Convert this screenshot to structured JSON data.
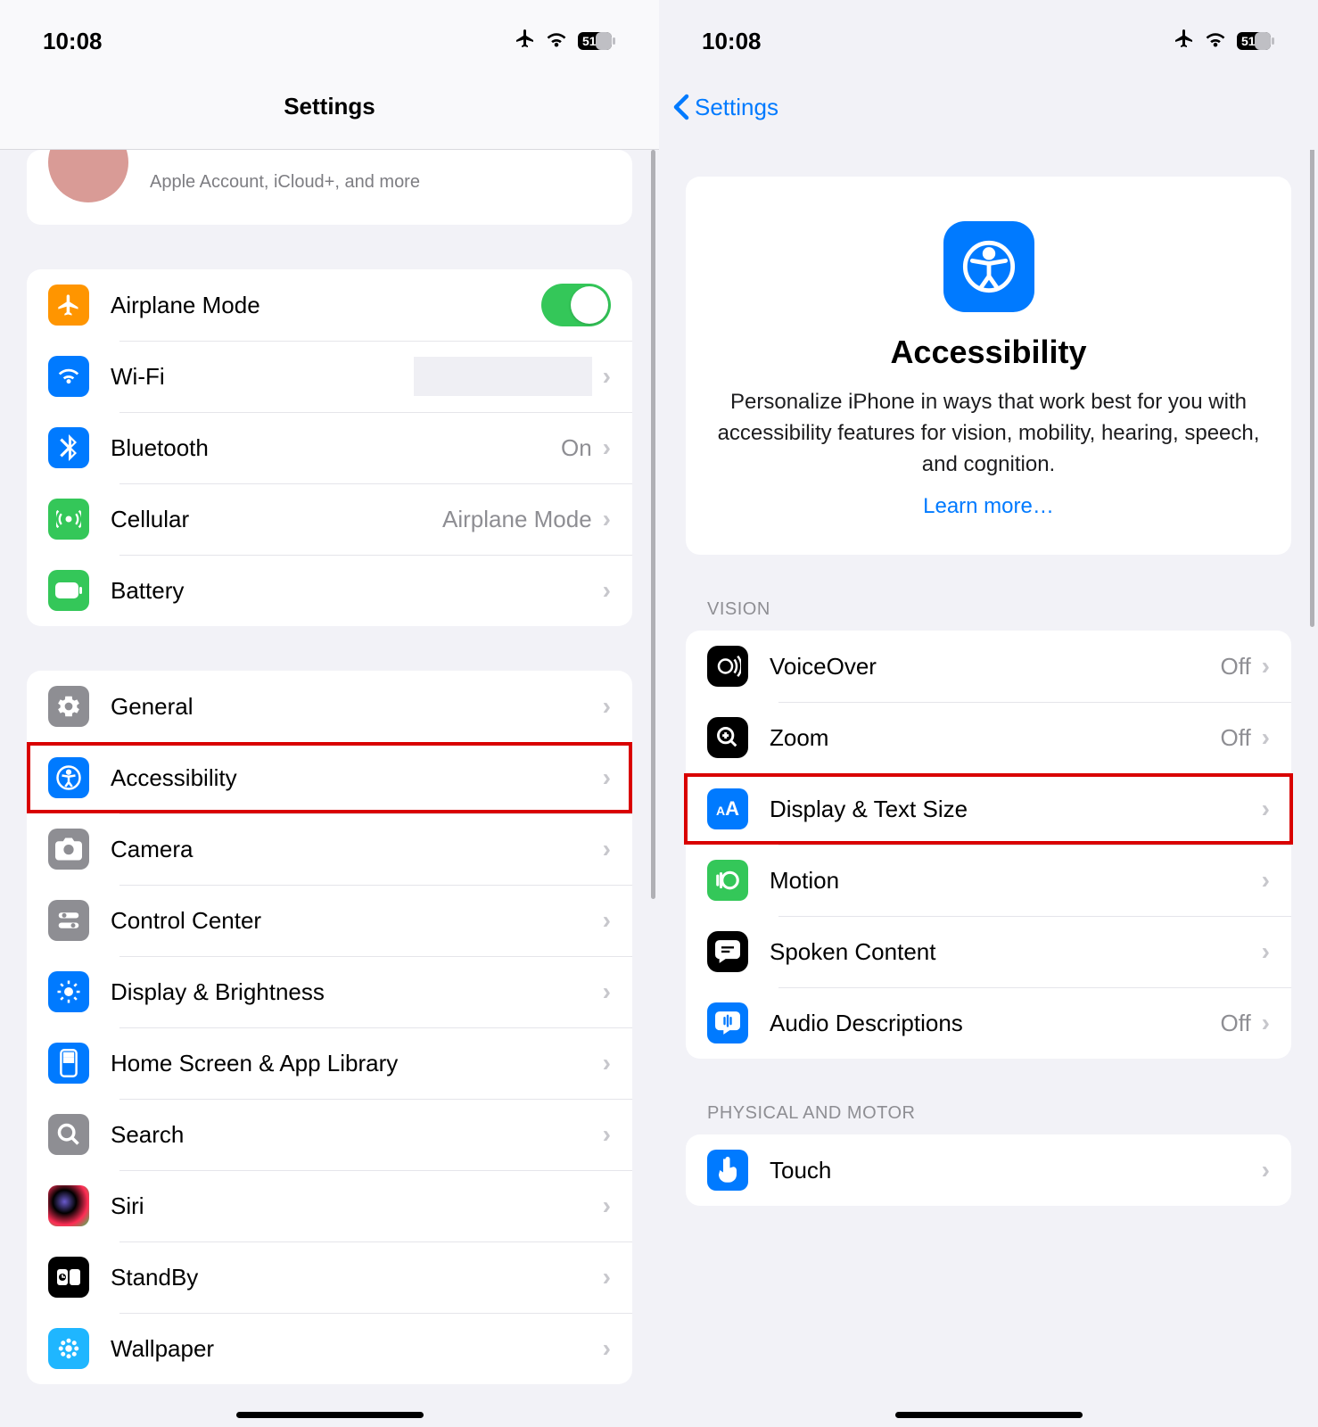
{
  "status": {
    "time": "10:08",
    "battery": "51"
  },
  "left": {
    "title": "Settings",
    "profile_sub": "Apple Account, iCloud+, and more",
    "connectivity": {
      "airplane": "Airplane Mode",
      "wifi": "Wi-Fi",
      "bluetooth": "Bluetooth",
      "bluetooth_val": "On",
      "cellular": "Cellular",
      "cellular_val": "Airplane Mode",
      "battery": "Battery"
    },
    "main": {
      "general": "General",
      "accessibility": "Accessibility",
      "camera": "Camera",
      "control_center": "Control Center",
      "display": "Display & Brightness",
      "home": "Home Screen & App Library",
      "search": "Search",
      "siri": "Siri",
      "standby": "StandBy",
      "wallpaper": "Wallpaper"
    }
  },
  "right": {
    "back": "Settings",
    "card": {
      "title": "Accessibility",
      "desc": "Personalize iPhone in ways that work best for you with accessibility features for vision, mobility, hearing, speech, and cognition.",
      "link": "Learn more…"
    },
    "vision_header": "VISION",
    "vision": {
      "voiceover": "VoiceOver",
      "voiceover_val": "Off",
      "zoom": "Zoom",
      "zoom_val": "Off",
      "display": "Display & Text Size",
      "motion": "Motion",
      "spoken": "Spoken Content",
      "audio": "Audio Descriptions",
      "audio_val": "Off"
    },
    "physical_header": "PHYSICAL AND MOTOR",
    "physical": {
      "touch": "Touch"
    }
  }
}
